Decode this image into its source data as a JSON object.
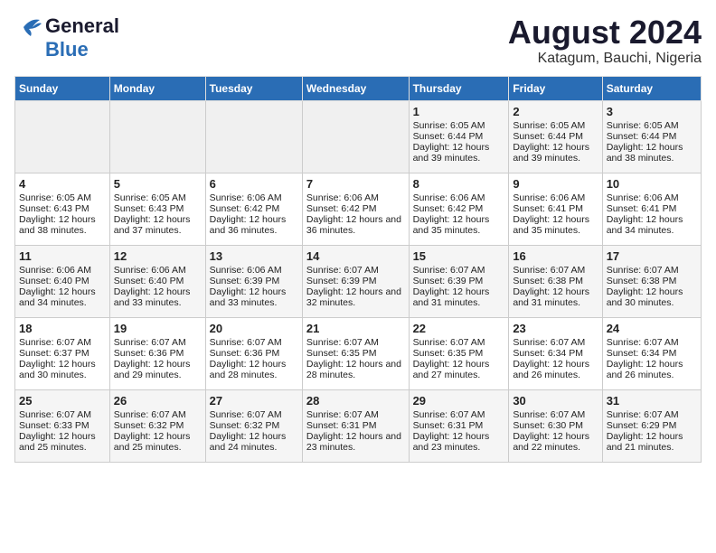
{
  "logo": {
    "line1": "General",
    "line2": "Blue"
  },
  "title": "August 2024",
  "subtitle": "Katagum, Bauchi, Nigeria",
  "days_of_week": [
    "Sunday",
    "Monday",
    "Tuesday",
    "Wednesday",
    "Thursday",
    "Friday",
    "Saturday"
  ],
  "weeks": [
    [
      {
        "day": "",
        "info": ""
      },
      {
        "day": "",
        "info": ""
      },
      {
        "day": "",
        "info": ""
      },
      {
        "day": "",
        "info": ""
      },
      {
        "day": "1",
        "sunrise": "6:05 AM",
        "sunset": "6:44 PM",
        "daylight": "12 hours and 39 minutes."
      },
      {
        "day": "2",
        "sunrise": "6:05 AM",
        "sunset": "6:44 PM",
        "daylight": "12 hours and 39 minutes."
      },
      {
        "day": "3",
        "sunrise": "6:05 AM",
        "sunset": "6:44 PM",
        "daylight": "12 hours and 38 minutes."
      }
    ],
    [
      {
        "day": "4",
        "sunrise": "6:05 AM",
        "sunset": "6:43 PM",
        "daylight": "12 hours and 38 minutes."
      },
      {
        "day": "5",
        "sunrise": "6:05 AM",
        "sunset": "6:43 PM",
        "daylight": "12 hours and 37 minutes."
      },
      {
        "day": "6",
        "sunrise": "6:06 AM",
        "sunset": "6:42 PM",
        "daylight": "12 hours and 36 minutes."
      },
      {
        "day": "7",
        "sunrise": "6:06 AM",
        "sunset": "6:42 PM",
        "daylight": "12 hours and 36 minutes."
      },
      {
        "day": "8",
        "sunrise": "6:06 AM",
        "sunset": "6:42 PM",
        "daylight": "12 hours and 35 minutes."
      },
      {
        "day": "9",
        "sunrise": "6:06 AM",
        "sunset": "6:41 PM",
        "daylight": "12 hours and 35 minutes."
      },
      {
        "day": "10",
        "sunrise": "6:06 AM",
        "sunset": "6:41 PM",
        "daylight": "12 hours and 34 minutes."
      }
    ],
    [
      {
        "day": "11",
        "sunrise": "6:06 AM",
        "sunset": "6:40 PM",
        "daylight": "12 hours and 34 minutes."
      },
      {
        "day": "12",
        "sunrise": "6:06 AM",
        "sunset": "6:40 PM",
        "daylight": "12 hours and 33 minutes."
      },
      {
        "day": "13",
        "sunrise": "6:06 AM",
        "sunset": "6:39 PM",
        "daylight": "12 hours and 33 minutes."
      },
      {
        "day": "14",
        "sunrise": "6:07 AM",
        "sunset": "6:39 PM",
        "daylight": "12 hours and 32 minutes."
      },
      {
        "day": "15",
        "sunrise": "6:07 AM",
        "sunset": "6:39 PM",
        "daylight": "12 hours and 31 minutes."
      },
      {
        "day": "16",
        "sunrise": "6:07 AM",
        "sunset": "6:38 PM",
        "daylight": "12 hours and 31 minutes."
      },
      {
        "day": "17",
        "sunrise": "6:07 AM",
        "sunset": "6:38 PM",
        "daylight": "12 hours and 30 minutes."
      }
    ],
    [
      {
        "day": "18",
        "sunrise": "6:07 AM",
        "sunset": "6:37 PM",
        "daylight": "12 hours and 30 minutes."
      },
      {
        "day": "19",
        "sunrise": "6:07 AM",
        "sunset": "6:36 PM",
        "daylight": "12 hours and 29 minutes."
      },
      {
        "day": "20",
        "sunrise": "6:07 AM",
        "sunset": "6:36 PM",
        "daylight": "12 hours and 28 minutes."
      },
      {
        "day": "21",
        "sunrise": "6:07 AM",
        "sunset": "6:35 PM",
        "daylight": "12 hours and 28 minutes."
      },
      {
        "day": "22",
        "sunrise": "6:07 AM",
        "sunset": "6:35 PM",
        "daylight": "12 hours and 27 minutes."
      },
      {
        "day": "23",
        "sunrise": "6:07 AM",
        "sunset": "6:34 PM",
        "daylight": "12 hours and 26 minutes."
      },
      {
        "day": "24",
        "sunrise": "6:07 AM",
        "sunset": "6:34 PM",
        "daylight": "12 hours and 26 minutes."
      }
    ],
    [
      {
        "day": "25",
        "sunrise": "6:07 AM",
        "sunset": "6:33 PM",
        "daylight": "12 hours and 25 minutes."
      },
      {
        "day": "26",
        "sunrise": "6:07 AM",
        "sunset": "6:32 PM",
        "daylight": "12 hours and 25 minutes."
      },
      {
        "day": "27",
        "sunrise": "6:07 AM",
        "sunset": "6:32 PM",
        "daylight": "12 hours and 24 minutes."
      },
      {
        "day": "28",
        "sunrise": "6:07 AM",
        "sunset": "6:31 PM",
        "daylight": "12 hours and 23 minutes."
      },
      {
        "day": "29",
        "sunrise": "6:07 AM",
        "sunset": "6:31 PM",
        "daylight": "12 hours and 23 minutes."
      },
      {
        "day": "30",
        "sunrise": "6:07 AM",
        "sunset": "6:30 PM",
        "daylight": "12 hours and 22 minutes."
      },
      {
        "day": "31",
        "sunrise": "6:07 AM",
        "sunset": "6:29 PM",
        "daylight": "12 hours and 21 minutes."
      }
    ]
  ]
}
